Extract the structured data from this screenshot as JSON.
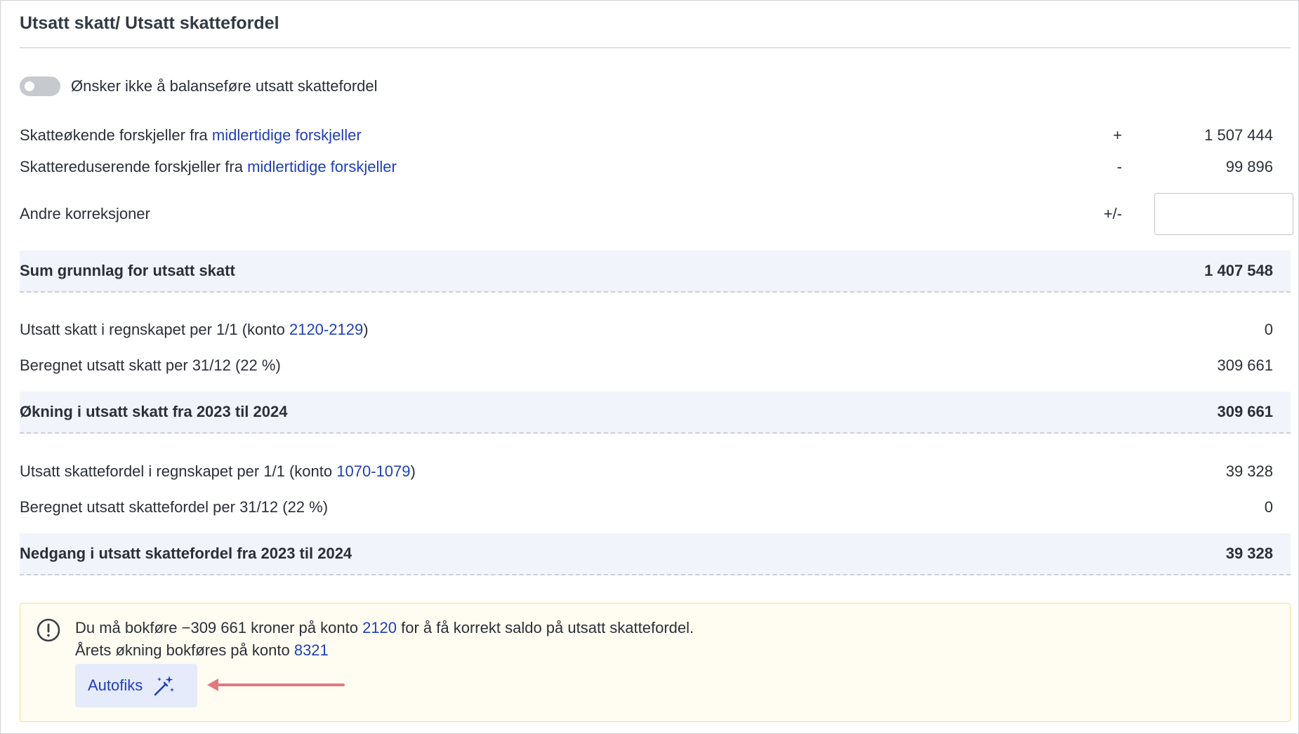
{
  "section": {
    "title": "Utsatt skatt/ Utsatt skattefordel"
  },
  "toggle": {
    "label": "Ønsker ikke å balanseføre utsatt skattefordel",
    "state": "off"
  },
  "rows": {
    "increasing": {
      "prefix": "Skatteøkende forskjeller fra ",
      "link": "midlertidige forskjeller",
      "sign": "+",
      "value": "1 507 444"
    },
    "reducing": {
      "prefix": "Skattereduserende forskjeller fra ",
      "link": "midlertidige forskjeller",
      "sign": "-",
      "value": "99 896"
    },
    "corrections": {
      "label": "Andre korreksjoner",
      "sign": "+/-",
      "input_value": ""
    },
    "sum_basis": {
      "label": "Sum grunnlag for utsatt skatt",
      "value": "1 407 548"
    },
    "deferred_tax_opening": {
      "prefix": "Utsatt skatt i regnskapet per 1/1 (konto ",
      "link": "2120-2129",
      "suffix": ")",
      "value": "0"
    },
    "deferred_tax_calc": {
      "label": "Beregnet utsatt skatt per 31/12 (22 %)",
      "value": "309 661"
    },
    "deferred_tax_increase": {
      "label": "Økning i utsatt skatt fra 2023 til 2024",
      "value": "309 661"
    },
    "asset_opening": {
      "prefix": "Utsatt skattefordel i regnskapet per 1/1 (konto ",
      "link": "1070-1079",
      "suffix": ")",
      "value": "39 328"
    },
    "asset_calc": {
      "label": "Beregnet utsatt skattefordel per 31/12 (22 %)",
      "value": "0"
    },
    "asset_decrease": {
      "label": "Nedgang i utsatt skattefordel fra 2023 til 2024",
      "value": "39 328"
    }
  },
  "alert": {
    "line1_prefix": "Du må bokføre −309 661 kroner på konto ",
    "line1_link": "2120",
    "line1_suffix": " for å få korrekt saldo på utsatt skattefordel.",
    "line2_prefix": "Årets økning bokføres på konto ",
    "line2_link": "8321",
    "button_label": "Autofiks"
  },
  "colors": {
    "link": "#1f3fb8",
    "sum_row_bg": "#f1f4fa",
    "alert_bg": "#fffcf1",
    "alert_border": "#f1df8e",
    "button_bg": "#e6ebfb",
    "arrow": "#e07a82"
  }
}
